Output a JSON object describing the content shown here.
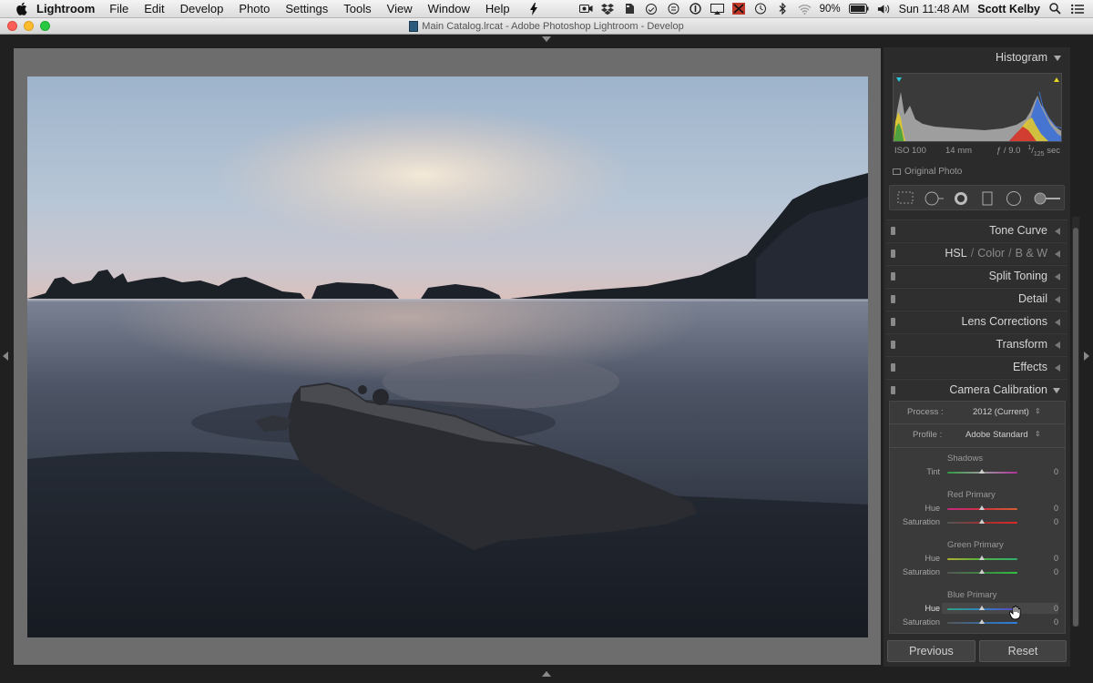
{
  "menubar": {
    "app_name": "Lightroom",
    "items": [
      "File",
      "Edit",
      "Develop",
      "Photo",
      "Settings",
      "Tools",
      "View",
      "Window",
      "Help"
    ],
    "battery": "90%",
    "clock": "Sun 11:48 AM",
    "user": "Scott Kelby"
  },
  "window": {
    "title": "Main Catalog.lrcat - Adobe Photoshop Lightroom - Develop"
  },
  "histogram": {
    "title": "Histogram",
    "iso": "ISO 100",
    "focal": "14 mm",
    "aperture": "ƒ / 9.0",
    "shutter_num": "1",
    "shutter_den": "125",
    "shutter_unit": "sec",
    "original_photo": "Original Photo"
  },
  "panels": {
    "tone_curve": "Tone Curve",
    "hsl": "HSL",
    "color": "Color",
    "bw": "B & W",
    "split_toning": "Split Toning",
    "detail": "Detail",
    "lens_corrections": "Lens Corrections",
    "transform": "Transform",
    "effects": "Effects",
    "camera_calibration": "Camera Calibration"
  },
  "calibration": {
    "process_label": "Process :",
    "process_value": "2012 (Current)",
    "profile_label": "Profile :",
    "profile_value": "Adobe Standard",
    "shadows_title": "Shadows",
    "tint_label": "Tint",
    "tint_value": "0",
    "red_title": "Red Primary",
    "red_hue_label": "Hue",
    "red_hue_value": "0",
    "red_sat_label": "Saturation",
    "red_sat_value": "0",
    "green_title": "Green Primary",
    "green_hue_label": "Hue",
    "green_hue_value": "0",
    "green_sat_label": "Saturation",
    "green_sat_value": "0",
    "blue_title": "Blue Primary",
    "blue_hue_label": "Hue",
    "blue_hue_value": "0",
    "blue_sat_label": "Saturation",
    "blue_sat_value": "0"
  },
  "buttons": {
    "previous": "Previous",
    "reset": "Reset"
  },
  "icons": {
    "apple": "apple-icon",
    "search": "search-icon",
    "wifi": "wifi-icon",
    "bluetooth": "bluetooth-icon",
    "volume": "volume-icon"
  }
}
